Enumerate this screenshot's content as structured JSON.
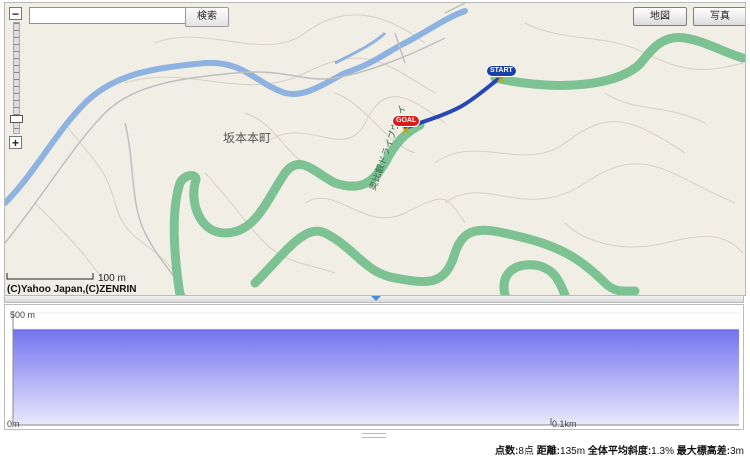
{
  "search": {
    "placeholder": "",
    "button_label": "検索"
  },
  "map_type": {
    "map_label": "地図",
    "photo_label": "写真"
  },
  "zoom": {
    "in_label": "+",
    "out_label": "−"
  },
  "map": {
    "place_label": "坂本本町",
    "scale_label": "100 m",
    "copyright": "(C)Yahoo Japan,(C)ZENRIN",
    "road_label": "奥比叡ドライブウェイ",
    "start_label": "START",
    "goal_label": "GOAL",
    "colors": {
      "river": "#8fb3e0",
      "road": "#7cc293",
      "route": "#2747b8",
      "background": "#f1eee6"
    }
  },
  "profile": {
    "y_top_label": "500 m",
    "y_bottom_label": "0m",
    "x_tick_label": "0.1km",
    "fill_color": "#7a7af0"
  },
  "stats": {
    "points_label": "点数:",
    "points_value": "8点",
    "distance_label": "距離:",
    "distance_value": "135m",
    "avg_slope_label": "全体平均斜度:",
    "avg_slope_value": "1.3%",
    "max_elev_diff_label": "最大標高差:",
    "max_elev_diff_value": "3m"
  }
}
